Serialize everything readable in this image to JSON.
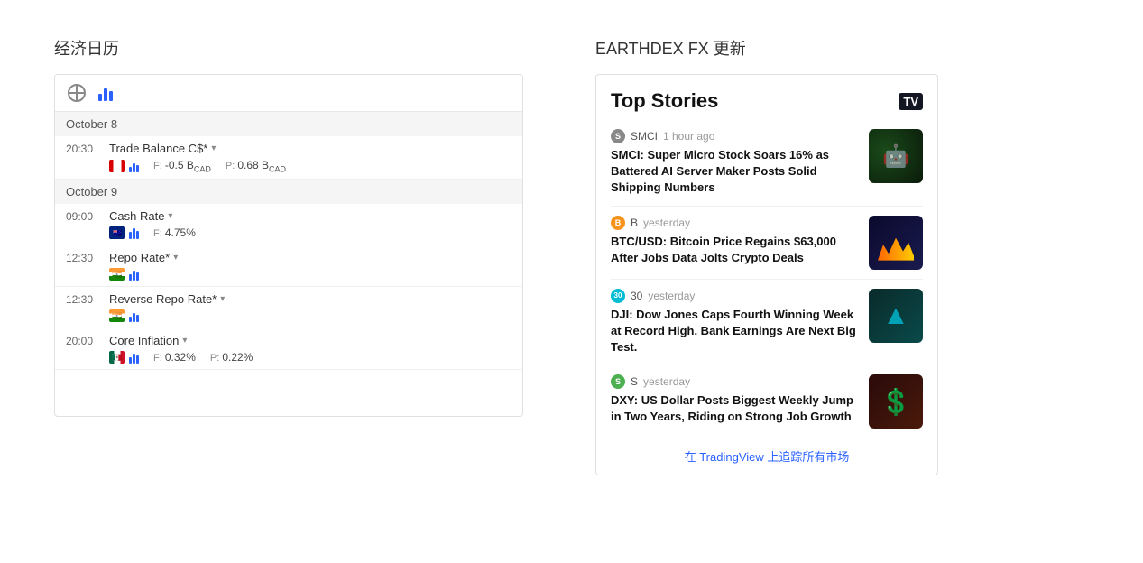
{
  "left": {
    "section_title": "经济日历",
    "calendar": {
      "dates": [
        {
          "date": "October 8",
          "events": [
            {
              "time": "20:30",
              "name": "Trade Balance C$*",
              "country": "CA",
              "forecast": "F: -0.5 B",
              "forecast_unit": "CAD",
              "previous": "P: 0.68 B",
              "previous_unit": "CAD"
            }
          ]
        },
        {
          "date": "October 9",
          "events": [
            {
              "time": "09:00",
              "name": "Cash Rate",
              "country": "AU",
              "forecast": "F: 4.75%",
              "previous": ""
            },
            {
              "time": "12:30",
              "name": "Repo Rate*",
              "country": "IN",
              "forecast": "",
              "previous": ""
            },
            {
              "time": "12:30",
              "name": "Reverse Repo Rate*",
              "country": "IN",
              "forecast": "",
              "previous": ""
            },
            {
              "time": "20:00",
              "name": "Core Inflation",
              "country": "MX",
              "forecast": "F: 0.32%",
              "previous": "P: 0.22%"
            }
          ]
        }
      ]
    }
  },
  "right": {
    "section_title": "EARTHDEX FX 更新",
    "news": {
      "header": "Top Stories",
      "logo": "TV",
      "items": [
        {
          "source": "SMCI",
          "source_icon": "S",
          "icon_style": "gray",
          "time": "1 hour ago",
          "headline": "SMCI: Super Micro Stock Soars 16% as Battered AI Server Maker Posts Solid Shipping Numbers",
          "thumb_type": "smci"
        },
        {
          "source": "B",
          "source_icon": "B",
          "icon_style": "orange",
          "time": "yesterday",
          "headline": "BTC/USD: Bitcoin Price Regains $63,000 After Jobs Data Jolts Crypto Deals",
          "thumb_type": "btc"
        },
        {
          "source": "30",
          "source_icon": "30",
          "icon_style": "teal",
          "time": "yesterday",
          "headline": "DJI: Dow Jones Caps Fourth Winning Week at Record High. Bank Earnings Are Next Big Test.",
          "thumb_type": "dji"
        },
        {
          "source": "S",
          "source_icon": "S",
          "icon_style": "green",
          "time": "yesterday",
          "headline": "DXY: US Dollar Posts Biggest Weekly Jump in Two Years, Riding on Strong Job Growth",
          "thumb_type": "dxy"
        }
      ],
      "footer_text": "在 TradingView 上追踪所有市场",
      "footer_link": "#"
    }
  }
}
